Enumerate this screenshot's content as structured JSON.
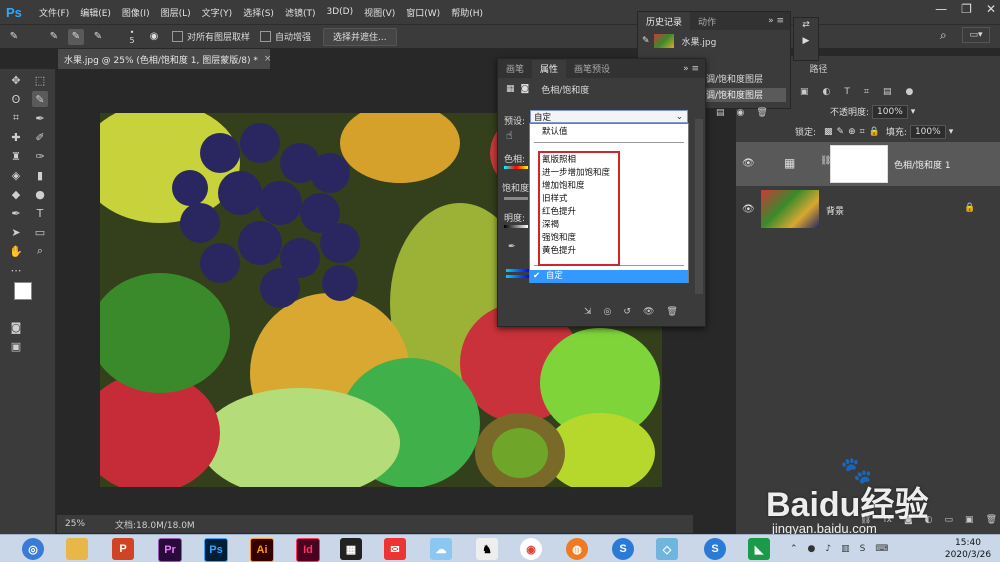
{
  "app": {
    "logo": "Ps"
  },
  "menu": [
    "文件(F)",
    "编辑(E)",
    "图像(I)",
    "图层(L)",
    "文字(Y)",
    "选择(S)",
    "滤镜(T)",
    "3D(D)",
    "视图(V)",
    "窗口(W)",
    "帮助(H)"
  ],
  "options_bar": {
    "size_value": "5",
    "sample_all_label": "对所有图层取样",
    "auto_enhance_label": "自动增强",
    "select_mask_label": "选择并遮住..."
  },
  "document": {
    "tab_title": "水果.jpg @ 25% (色相/饱和度 1, 图层蒙版/8) *",
    "close": "×",
    "zoom": "25%",
    "doc_size": "文档:18.0M/18.0M"
  },
  "history_panel": {
    "tab_history": "历史记录",
    "tab_actions": "动作",
    "snapshot_name": "水果.jpg",
    "step1": "调/饱和度图层",
    "step2": "调/饱和度图层"
  },
  "properties_panel": {
    "tab_brush": "画笔",
    "tab_properties": "属性",
    "tab_brush_presets": "画笔预设",
    "adjustment_title": "色相/饱和度",
    "preset_label": "预设:",
    "preset_value": "自定",
    "hue_label": "色相:",
    "saturation_label": "饱和度",
    "lightness_label": "明度:",
    "preset_options": [
      "默认值",
      "氰版照相",
      "进一步增加饱和度",
      "增加饱和度",
      "旧样式",
      "红色提升",
      "深褐",
      "强饱和度",
      "黄色提升"
    ],
    "selected_option": "自定",
    "checkmark": "✔"
  },
  "layers_panel": {
    "tab_paths": "路径",
    "opacity_label": "不透明度:",
    "opacity_value": "100%",
    "fill_label": "填充:",
    "fill_value": "100%",
    "lock_label": "锁定:",
    "layers": [
      {
        "name": "色相/饱和度 1"
      },
      {
        "name": "背景"
      }
    ]
  },
  "taskbar": {
    "apps": [
      "P",
      "Pr",
      "Ps",
      "Ai",
      "Id"
    ],
    "time": "15:40",
    "date": "2020/3/26"
  },
  "watermark": {
    "brand": "Baidu经验",
    "url": "jingyan.baidu.com"
  },
  "colors": {
    "accent": "#31a8ff",
    "highlight_box": "#d0262b",
    "selection": "#3399ff"
  }
}
